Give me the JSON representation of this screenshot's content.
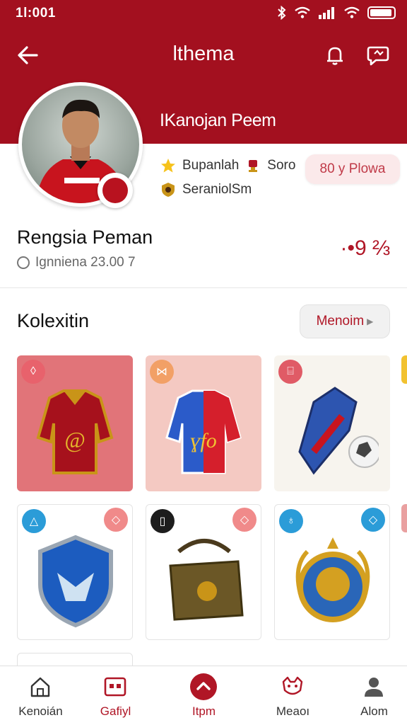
{
  "status_bar": {
    "time": "1l:001"
  },
  "header": {
    "title": "lthema"
  },
  "profile": {
    "name": "IKanojan Peem",
    "tag1": "Bupanlah",
    "tag2": "Soro",
    "tag3": "SeraniolSm",
    "follow_label": "80 y Plowa"
  },
  "summary": {
    "title": "Rengsia Peman",
    "subtitle": "Ignniena 23.00 7",
    "score": "·•9 ⅔"
  },
  "collection": {
    "title": "Kolexitin",
    "more_label": "Menoim",
    "items": [
      {
        "name": "red-gold-jersey",
        "badge_color": "#e8626c"
      },
      {
        "name": "red-blue-jersey",
        "badge_color": "#f2a066"
      },
      {
        "name": "football-boot",
        "badge_color": "#e05b66"
      },
      {
        "name": "blue-shield",
        "badge_color": "#2b9cd8"
      },
      {
        "name": "bag",
        "badge_color": "#1d1d1d"
      },
      {
        "name": "lion-crest",
        "badge_color": "#2b9cd8"
      }
    ]
  },
  "bottom_nav": [
    {
      "label": "Kenoián",
      "icon": "home-icon"
    },
    {
      "label": "Gafiyl",
      "icon": "gallery-icon"
    },
    {
      "label": "Itpm",
      "icon": "up-arrow-icon"
    },
    {
      "label": "Meaoı",
      "icon": "mascot-icon"
    },
    {
      "label": "Alom",
      "icon": "person-icon"
    }
  ],
  "colors": {
    "brand": "#a3101f",
    "accent": "#b01626"
  }
}
